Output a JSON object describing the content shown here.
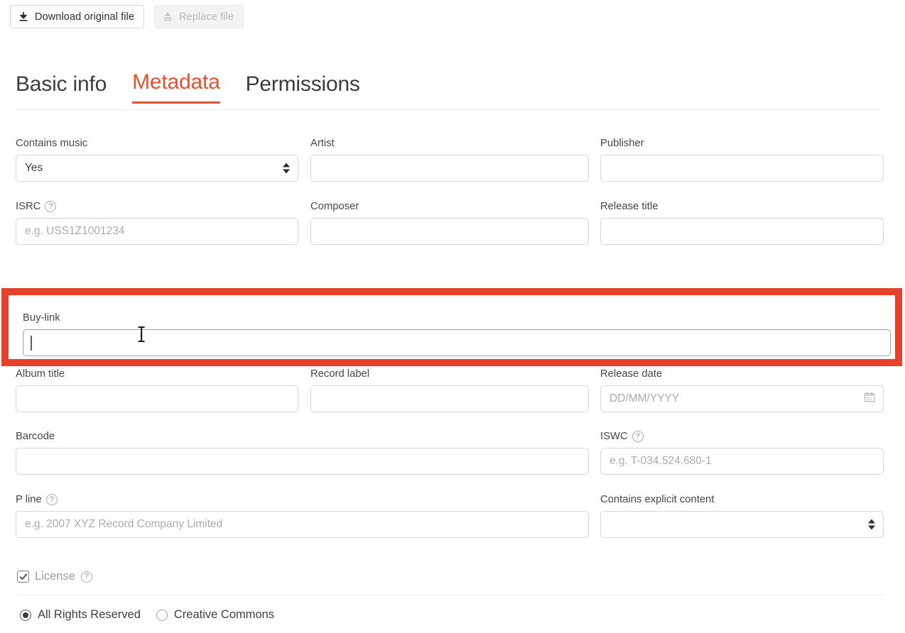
{
  "toolbar": {
    "download_label": "Download original file",
    "download_icon": "download-icon",
    "replace_label": "Replace file",
    "replace_icon": "upload-icon",
    "replace_disabled": true
  },
  "tabs": [
    {
      "label": "Basic info",
      "active": false
    },
    {
      "label": "Metadata",
      "active": true
    },
    {
      "label": "Permissions",
      "active": false
    }
  ],
  "accent_color": "#e05330",
  "highlight_color": "#e8412a",
  "fields": {
    "contains_music": {
      "label": "Contains music",
      "value": "Yes",
      "type": "select"
    },
    "artist": {
      "label": "Artist",
      "value": "",
      "placeholder": ""
    },
    "publisher": {
      "label": "Publisher",
      "value": "",
      "placeholder": ""
    },
    "isrc": {
      "label": "ISRC",
      "help": "?",
      "value": "",
      "placeholder": "e.g. USS1Z1001234"
    },
    "composer": {
      "label": "Composer",
      "value": "",
      "placeholder": ""
    },
    "release_title": {
      "label": "Release title",
      "value": "",
      "placeholder": ""
    },
    "buy_link": {
      "label": "Buy-link",
      "value": "",
      "placeholder": "",
      "focused": true,
      "highlighted": true
    },
    "album_title": {
      "label": "Album title",
      "value": "",
      "placeholder": ""
    },
    "record_label": {
      "label": "Record label",
      "value": "",
      "placeholder": ""
    },
    "release_date": {
      "label": "Release date",
      "value": "",
      "placeholder": "DD/MM/YYYY",
      "icon": "calendar-icon"
    },
    "barcode": {
      "label": "Barcode",
      "value": "",
      "placeholder": ""
    },
    "iswc": {
      "label": "ISWC",
      "help": "?",
      "value": "",
      "placeholder": "e.g. T-034.524.680-1"
    },
    "p_line": {
      "label": "P line",
      "help": "?",
      "value": "",
      "placeholder": "e.g. 2007 XYZ Record Company Limited"
    },
    "contains_explicit": {
      "label": "Contains explicit content",
      "value": "",
      "type": "select"
    },
    "license": {
      "label": "License",
      "help": "?",
      "checked": true
    },
    "license_options": [
      {
        "label": "All Rights Reserved",
        "selected": true
      },
      {
        "label": "Creative Commons",
        "selected": false
      }
    ]
  }
}
